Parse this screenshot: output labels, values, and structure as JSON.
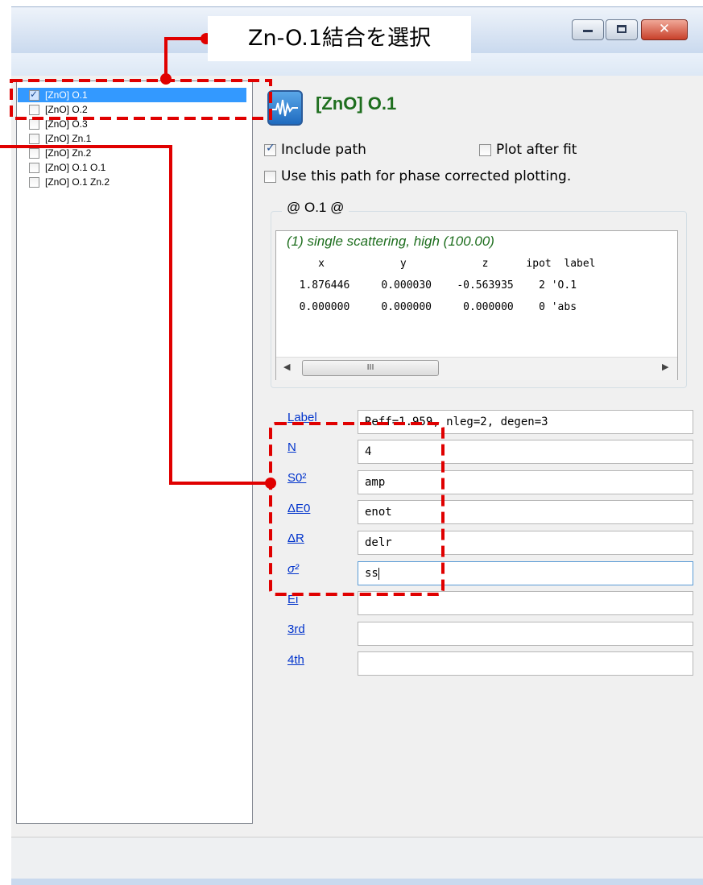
{
  "window": {
    "callout_text": "Zn-O.1結合を選択"
  },
  "path_list": {
    "items": [
      {
        "label": "[ZnO] O.1",
        "checked": true,
        "selected": true
      },
      {
        "label": "[ZnO] O.2",
        "checked": false,
        "selected": false
      },
      {
        "label": "[ZnO] O.3",
        "checked": false,
        "selected": false
      },
      {
        "label": "[ZnO] Zn.1",
        "checked": false,
        "selected": false
      },
      {
        "label": "[ZnO] Zn.2",
        "checked": false,
        "selected": false
      },
      {
        "label": "[ZnO] O.1 O.1",
        "checked": false,
        "selected": false
      },
      {
        "label": "[ZnO] O.1 Zn.2",
        "checked": false,
        "selected": false
      }
    ]
  },
  "path_panel": {
    "title": "[ZnO] O.1",
    "include_path_label": "Include path",
    "include_path_checked": true,
    "plot_after_fit_label": "Plot after fit",
    "plot_after_fit_checked": false,
    "phase_corrected_label": "Use this path for phase corrected plotting.",
    "phase_corrected_checked": false,
    "group_title": "@ O.1   @",
    "geometry": {
      "header": "(1) single scattering, high (100.00)",
      "columns": "     x            y            z      ipot  label",
      "rows": [
        "  1.876446     0.000030    -0.563935    2 'O.1",
        "  0.000000     0.000000     0.000000    0 'abs"
      ],
      "scroll_thumb_glyph": "III"
    },
    "params": [
      {
        "label": "Label",
        "value": "Reff=1.959, nleg=2, degen=3"
      },
      {
        "label": "N",
        "value": "4"
      },
      {
        "label": "S0²",
        "value": "amp"
      },
      {
        "label": "ΔE0",
        "value": "enot"
      },
      {
        "label": "ΔR",
        "value": "delr"
      },
      {
        "label": "σ²",
        "value": "ss"
      },
      {
        "label": "Ei",
        "value": ""
      },
      {
        "label": "3rd",
        "value": ""
      },
      {
        "label": "4th",
        "value": ""
      }
    ]
  },
  "colors": {
    "highlight": "#3399ff",
    "path_title": "#1e6e1e",
    "link": "#0033cc",
    "callout": "#e00000"
  }
}
